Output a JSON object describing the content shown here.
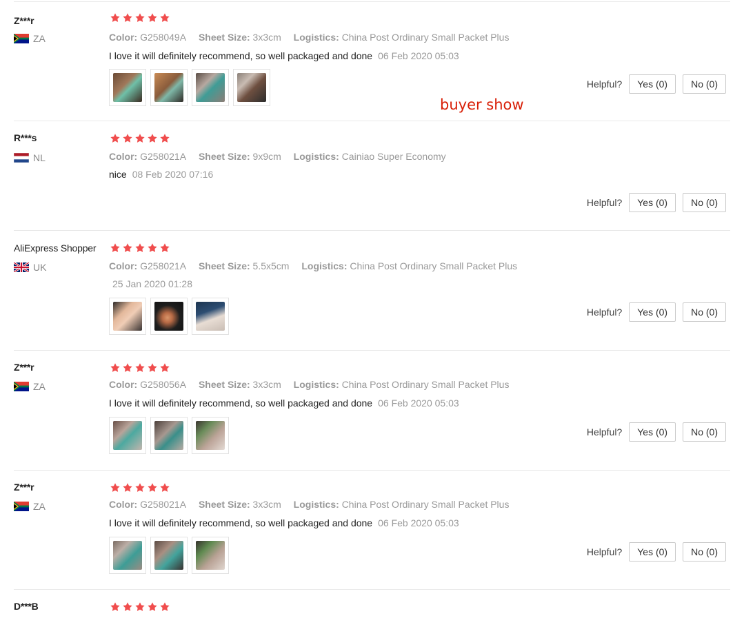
{
  "labels": {
    "color": "Color:",
    "size": "Sheet Size:",
    "logistics": "Logistics:",
    "helpful": "Helpful?"
  },
  "overlay": {
    "buyer_show": "buyer show"
  },
  "colors": {
    "star": "#f04d4d",
    "overlay_text": "#d81e06"
  },
  "reviews": [
    {
      "user": "Z***r",
      "country": "ZA",
      "flag": "za-flag-icon",
      "rating": 5,
      "color": "G258049A",
      "size": "3x3cm",
      "logistics": "China Post Ordinary Small Packet Plus",
      "text": "I love it will definitely recommend, so well packaged and done",
      "date": "06 Feb 2020 05:03",
      "photos": 4,
      "yes": "Yes (0)",
      "no": "No (0)"
    },
    {
      "user": "R***s",
      "country": "NL",
      "flag": "nl-flag-icon",
      "rating": 5,
      "color": "G258021A",
      "size": "9x9cm",
      "logistics": "Cainiao Super Economy",
      "text": "nice",
      "date": "08 Feb 2020 07:16",
      "photos": 0,
      "yes": "Yes (0)",
      "no": "No (0)"
    },
    {
      "user": "AliExpress Shopper",
      "country": "UK",
      "flag": "uk-flag-icon",
      "rating": 5,
      "color": "G258021A",
      "size": "5.5x5cm",
      "logistics": "China Post Ordinary Small Packet Plus",
      "text": "",
      "date": "25 Jan 2020 01:28",
      "photos": 3,
      "yes": "Yes (0)",
      "no": "No (0)"
    },
    {
      "user": "Z***r",
      "country": "ZA",
      "flag": "za-flag-icon",
      "rating": 5,
      "color": "G258056A",
      "size": "3x3cm",
      "logistics": "China Post Ordinary Small Packet Plus",
      "text": "I love it will definitely recommend, so well packaged and done",
      "date": "06 Feb 2020 05:03",
      "photos": 3,
      "yes": "Yes (0)",
      "no": "No (0)"
    },
    {
      "user": "Z***r",
      "country": "ZA",
      "flag": "za-flag-icon",
      "rating": 5,
      "color": "G258021A",
      "size": "3x3cm",
      "logistics": "China Post Ordinary Small Packet Plus",
      "text": "I love it will definitely recommend, so well packaged and done",
      "date": "06 Feb 2020 05:03",
      "photos": 3,
      "yes": "Yes (0)",
      "no": "No (0)"
    },
    {
      "user": "D***B",
      "rating": 5
    }
  ]
}
